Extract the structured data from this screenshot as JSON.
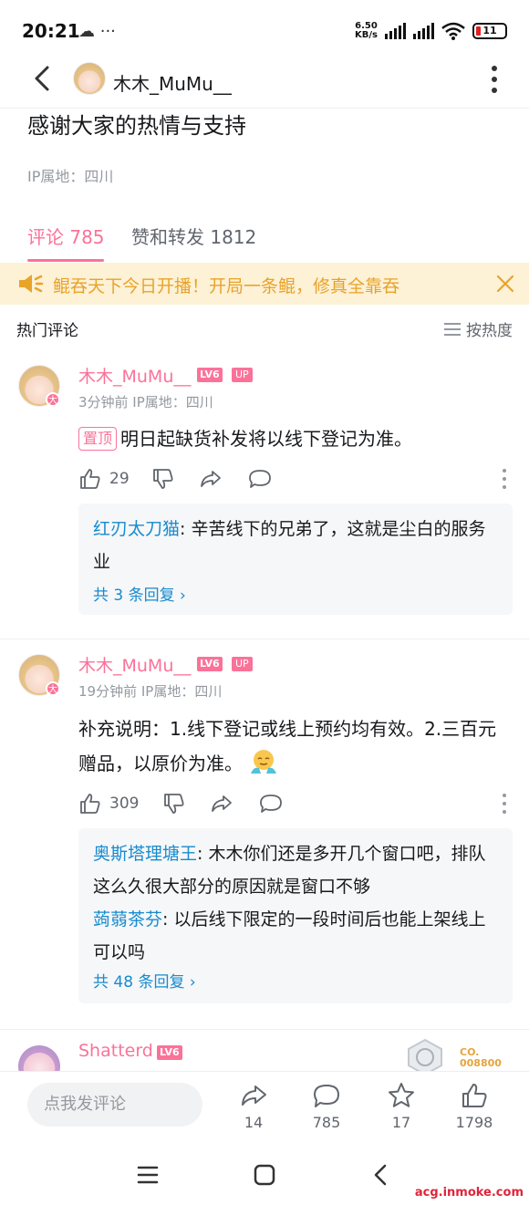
{
  "status_bar": {
    "time": "20:21",
    "left_icons": "☁ ···",
    "net_speed_value": "6.50",
    "net_speed_unit": "KB/s",
    "battery": "11",
    "battery_color": "#e02020"
  },
  "nav": {
    "username": "木木_MuMu__"
  },
  "post": {
    "text": "感谢大家的热情与支持",
    "ip": "IP属地：四川"
  },
  "tabs": [
    {
      "label": "评论 785",
      "active": true
    },
    {
      "label": "赞和转发 1812",
      "active": false
    }
  ],
  "notice": {
    "text": "鲲吞天下今日开播！开局一条鲲，修真全靠吞",
    "icon": "speaker-icon"
  },
  "section": {
    "title": "热门评论",
    "sort_label": "按热度"
  },
  "comments": [
    {
      "user": "木木_MuMu__",
      "level": "LV6",
      "up_tag": "UP",
      "avatar_badge": "大",
      "meta": "3分钟前 IP属地：四川",
      "pin_label": "置顶",
      "content": "明日起缺货补发将以线下登记为准。",
      "likes": "29",
      "replies": [
        {
          "author": "红刃太刀猫",
          "text": ": 辛苦线下的兄弟了，这就是尘白的服务业"
        }
      ],
      "reply_count": "共 3 条回复 ›"
    },
    {
      "user": "木木_MuMu__",
      "level": "LV6",
      "up_tag": "UP",
      "avatar_badge": "大",
      "meta": "19分钟前 IP属地：四川",
      "content": "补充说明：1.线下登记或线上预约均有效。2.三百元赠品，以原价为准。",
      "likes": "309",
      "replies": [
        {
          "author": "奥斯塔理塘王",
          "text": ": 木木你们还是多开几个窗口吧，排队这么久很大部分的原因就是窗口不够"
        },
        {
          "author": "蒟蒻茶芬",
          "text": ": 以后线下限定的一段时间后也能上架线上可以吗"
        }
      ],
      "reply_count": "共 48 条回复 ›"
    },
    {
      "user": "Shatterd",
      "level": "LV6",
      "medal_text_1": "CO.",
      "medal_text_2": "008800"
    }
  ],
  "bottom_bar": {
    "input_placeholder": "点我发评论",
    "share_count": "14",
    "comment_count": "785",
    "favorite_count": "17",
    "like_count": "1798"
  },
  "watermark": "acg.inmoke.com",
  "colors": {
    "accent": "#fb7299",
    "link": "#178bcf",
    "notice_bg": "#fdf1d6",
    "notice_text": "#e8a329"
  }
}
